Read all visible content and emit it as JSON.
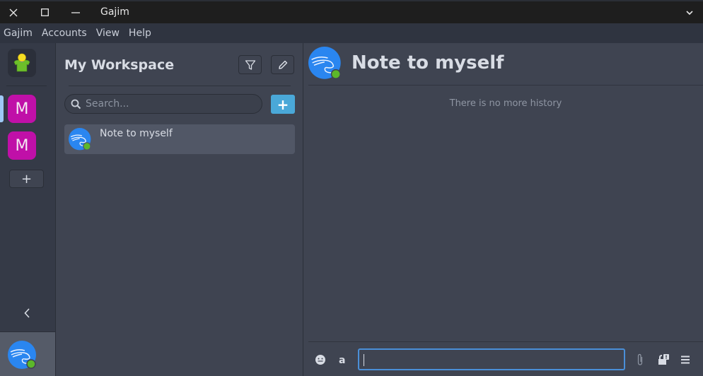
{
  "window": {
    "title": "Gajim",
    "buttons": [
      "close",
      "maximize",
      "minimize"
    ],
    "menu_button": "chevron-down"
  },
  "menubar": {
    "items": [
      "Gajim",
      "Accounts",
      "View",
      "Help"
    ]
  },
  "account_rail": {
    "own_account_icon": "user-avatar-icon",
    "accounts": [
      {
        "initial": "M",
        "color": "#c010a8",
        "selected": true
      },
      {
        "initial": "M",
        "color": "#c010a8",
        "selected": false
      }
    ],
    "add_label": "+",
    "collapse_label": "‹",
    "selection_color": "#9ec9f5"
  },
  "chat_list": {
    "workspace_title": "My Workspace",
    "filter_icon": "filter-icon",
    "edit_icon": "pencil-icon",
    "search_placeholder": "Search...",
    "search_value": "",
    "add_label": "+",
    "add_color": "#4aa8d8",
    "chats": [
      {
        "name": "Note to myself",
        "status": "online",
        "status_color": "#5cb82a"
      }
    ]
  },
  "chat": {
    "title": "Note to myself",
    "no_history": "There is no more history",
    "message_value": "",
    "controls": {
      "emoji_icon": "emoji-icon",
      "format_icon": "format-icon",
      "attach_icon": "paperclip-icon",
      "encryption_icon": "unencrypted-icon",
      "menu_icon": "menu-icon"
    },
    "focus_color": "#4a8fd8"
  }
}
